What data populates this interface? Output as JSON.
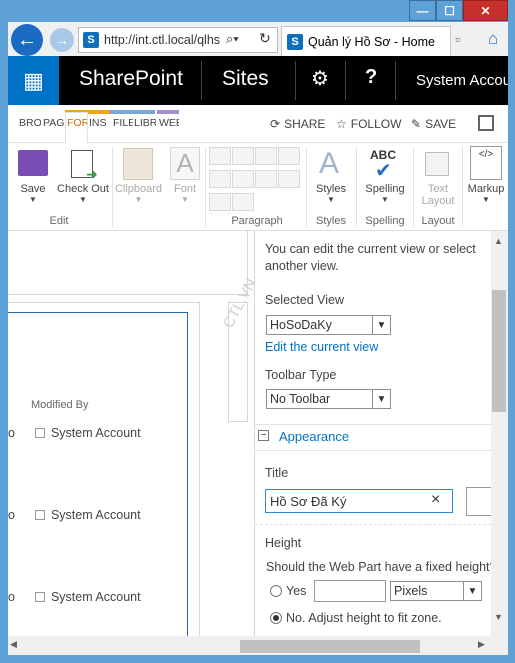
{
  "browser": {
    "url": "http://int.ctl.local/qlhs",
    "tab_title": "Quản lý Hồ Sơ - Home",
    "search_icon": "search-icon",
    "refresh_icon": "refresh-icon"
  },
  "suite": {
    "brand": "SharePoint",
    "sites": "Sites",
    "settings_icon": "⚙",
    "help": "?",
    "user": "System Account"
  },
  "ribbon": {
    "tabs": [
      "BRO",
      "PAG",
      "FOR",
      "INS",
      "FILE",
      "LIBR",
      "WEB"
    ],
    "share": "SHARE",
    "follow": "FOLLOW",
    "save": "SAVE",
    "buttons": {
      "save": "Save",
      "checkout": "Check Out",
      "clipboard": "Clipboard",
      "font": "Font",
      "styles": "Styles",
      "spelling": "Spelling",
      "spelling_icon_text": "ABC",
      "text_layout_1": "Text",
      "text_layout_2": "Layout",
      "markup": "Markup"
    },
    "groups": {
      "edit": "Edit",
      "paragraph": "Paragraph",
      "styles": "Styles",
      "spelling": "Spelling",
      "layout": "Layout"
    }
  },
  "list": {
    "column_modified_by": "Modified By",
    "rows": [
      {
        "prefix": "o",
        "value": "System Account"
      },
      {
        "prefix": "o",
        "value": "System Account"
      },
      {
        "prefix": "o",
        "value": "System Account"
      }
    ]
  },
  "toolpane": {
    "intro": "You can edit the current view or select another view.",
    "selected_view_label": "Selected View",
    "selected_view_value": "HoSoDaKy",
    "edit_view_link": "Edit the current view",
    "toolbar_type_label": "Toolbar Type",
    "toolbar_type_value": "No Toolbar",
    "appearance_toggle": "−",
    "appearance_label": "Appearance",
    "title_label": "Title",
    "title_value": "Hồ Sơ Đã Ký",
    "clear_icon": "×",
    "height_label": "Height",
    "height_question": "Should the Web Part have a fixed height?",
    "yes_label": "Yes",
    "units_value": "Pixels",
    "no_label": "No. Adjust height to fit zone."
  },
  "watermark": "CTL.VN"
}
